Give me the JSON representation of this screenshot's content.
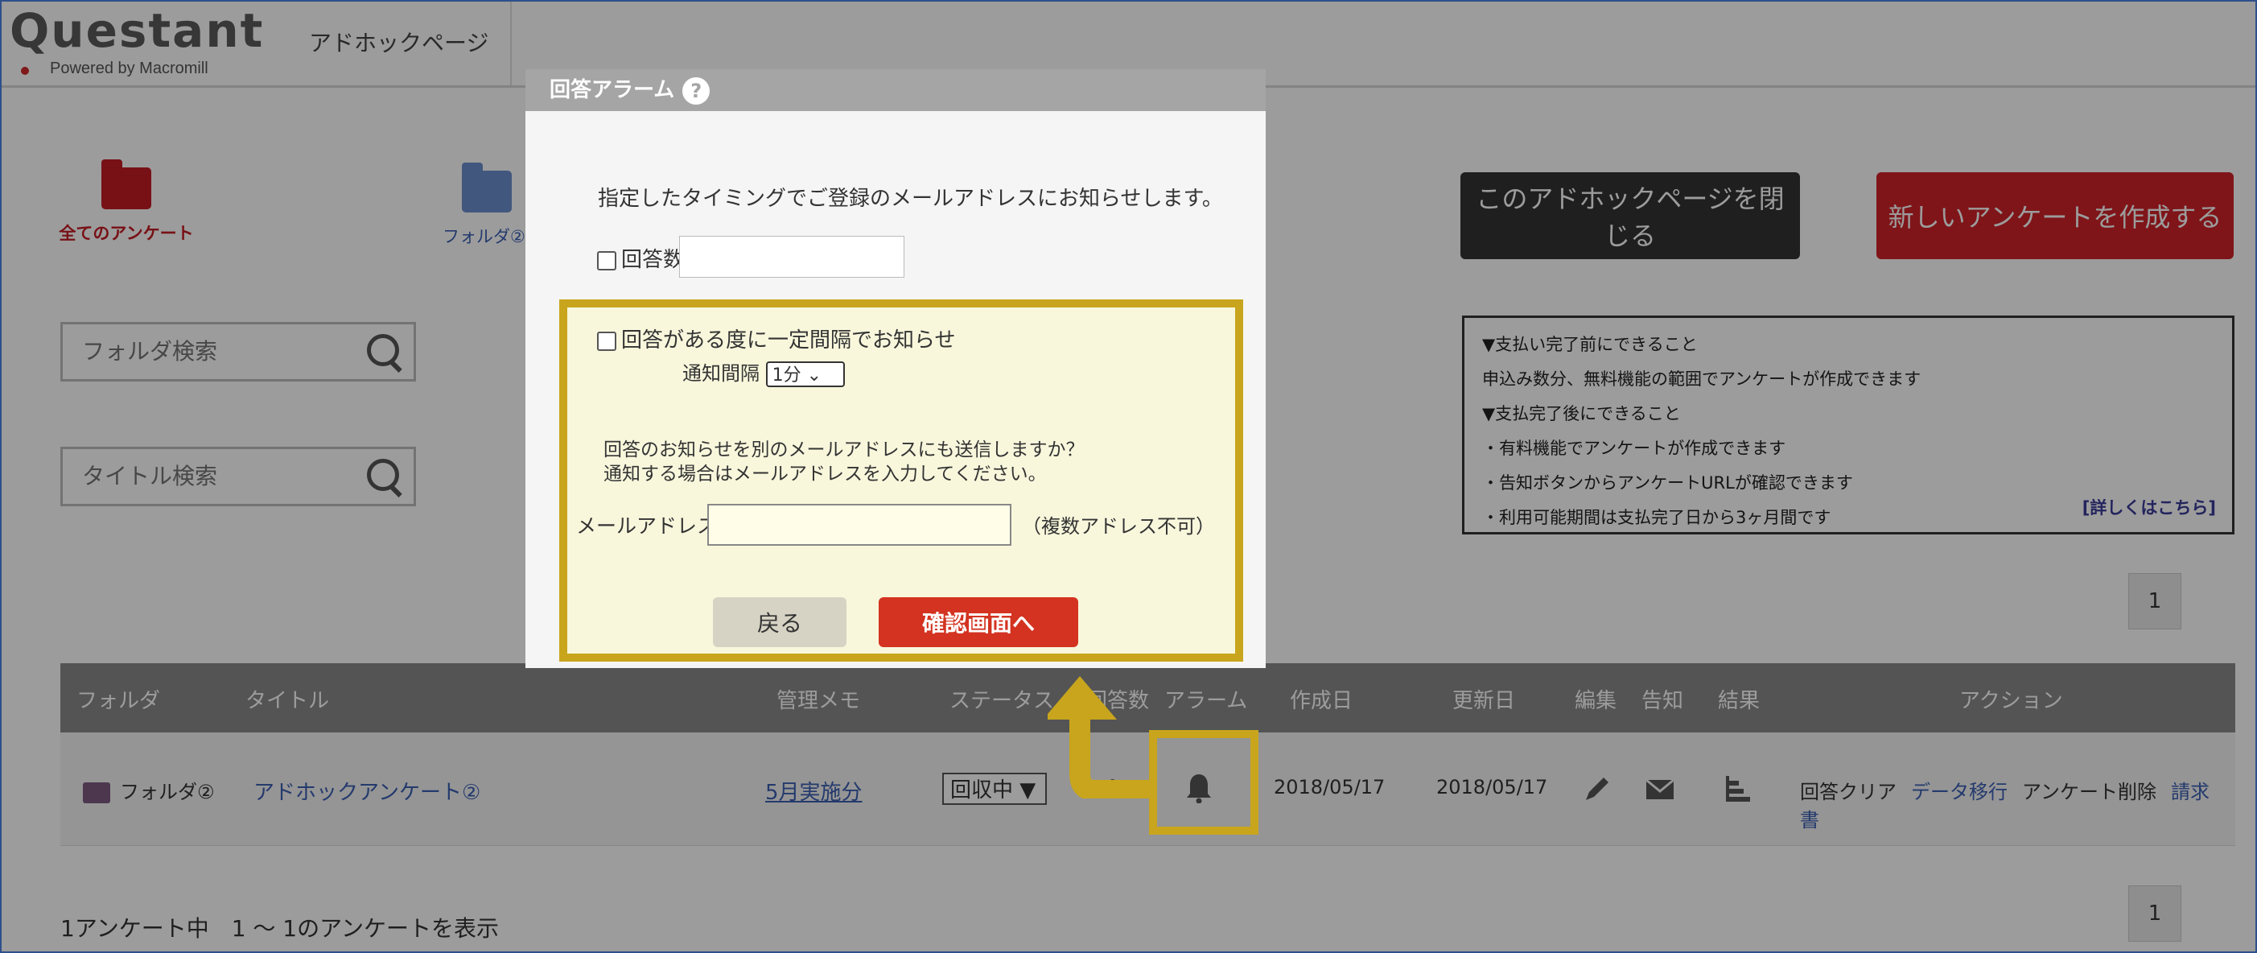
{
  "header": {
    "logo_main": "Questant",
    "logo_sub": "Powered by Macromill",
    "page_name": "アドホックページ"
  },
  "folders": {
    "all_label": "全てのアンケート",
    "folder2_label": "フォルダ②"
  },
  "search": {
    "folder_placeholder": "フォルダ検索",
    "title_placeholder": "タイトル検索"
  },
  "buttons": {
    "close_page": "このアドホックページを閉じる",
    "new_survey": "新しいアンケートを作成する"
  },
  "info": {
    "lines": [
      "▼支払い完了前にできること",
      "申込み数分、無料機能の範囲でアンケートが作成できます",
      "▼支払完了後にできること",
      "・有料機能でアンケートが作成できます",
      "・告知ボタンからアンケートURLが確認できます",
      "・利用可能期間は支払完了日から3ヶ月間です"
    ],
    "more_link": "[詳しくはこちら]"
  },
  "pager": {
    "page": "1"
  },
  "table": {
    "headers": [
      "フォルダ",
      "タイトル",
      "管理メモ",
      "ステータス",
      "回答数",
      "アラーム",
      "作成日",
      "更新日",
      "編集",
      "告知",
      "結果",
      "アクション"
    ],
    "row": {
      "folder": "フォルダ②",
      "title": "アドホックアンケート②",
      "memo": "5月実施分",
      "status": "回収中 ▼",
      "responses": "0",
      "created": "2018/05/17",
      "updated": "2018/05/17",
      "actions": [
        "回答クリア",
        "データ移行",
        "アンケート削除",
        "請求書"
      ]
    }
  },
  "footer": {
    "count_text": "1アンケート中　1 ～ 1のアンケートを表示"
  },
  "modal": {
    "title": "回答アラーム",
    "help": "?",
    "intro": "指定したタイミングでご登録のメールアドレスにお知らせします。",
    "count_label": "回答数",
    "interval_check_label": "回答がある度に一定間隔でお知らせ",
    "interval_label": "通知間隔",
    "interval_value": "1分",
    "other_mail_q1": "回答のお知らせを別のメールアドレスにも送信しますか？",
    "other_mail_q2": "通知する場合はメールアドレスを入力してください。",
    "mail_label": "メールアドレス",
    "mail_note": "（複数アドレス不可）",
    "back": "戻る",
    "confirm": "確認画面へ"
  },
  "colors": {
    "accent_red": "#d0232a",
    "highlight_gold": "#c8a51c",
    "link_blue": "#3b5fb3"
  },
  "icons": [
    "search-icon",
    "folder-icon",
    "bell-icon",
    "edit-icon",
    "mail-icon",
    "bar-chart-icon",
    "help-icon",
    "arrow-icon"
  ]
}
